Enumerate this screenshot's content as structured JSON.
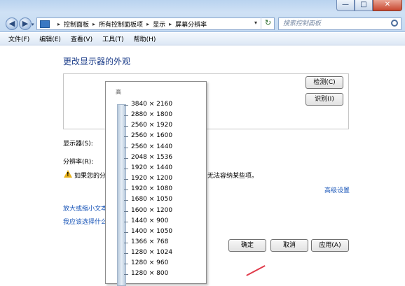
{
  "window": {
    "controls": {
      "minimize": "—",
      "maximize": "□",
      "close": "✕"
    }
  },
  "nav": {
    "back": "◀",
    "forward": "▶",
    "dropdown": "▾"
  },
  "address": {
    "crumbs": [
      "控制面板",
      "所有控制面板项",
      "显示",
      "屏幕分辨率"
    ],
    "separator": "▸",
    "refresh": "↻",
    "dropdown": "▾"
  },
  "search": {
    "placeholder": "搜索控制面板"
  },
  "menu": [
    "文件(F)",
    "编辑(E)",
    "查看(V)",
    "工具(T)",
    "帮助(H)"
  ],
  "page": {
    "title": "更改显示器的外观",
    "detect_button": "检测(C)",
    "identify_button": "识别(I)",
    "display_label": "显示器(S):",
    "resolution_label": "分辨率(R):",
    "warning_text_left": "如果您的分",
    "warning_text_right": "无法容纳某些项。",
    "warning_icon": "!",
    "advanced_link": "高级设置",
    "link_text_size": "放大或缩小文本",
    "link_choose": "我应该选择什么",
    "ok_button": "确定",
    "cancel_button": "取消",
    "apply_button": "应用(A)"
  },
  "resolution_list": {
    "high_label": "高",
    "options": [
      "3840 × 2160",
      "2880 × 1800",
      "2560 × 1920",
      "2560 × 1600",
      "2560 × 1440",
      "2048 × 1536",
      "1920 × 1440",
      "1920 × 1200",
      "1920 × 1080",
      "1680 × 1050",
      "1600 × 1200",
      "1440 × 900",
      "1400 × 1050",
      "1366 × 768",
      "1280 × 1024",
      "1280 × 960",
      "1280 × 800"
    ]
  }
}
